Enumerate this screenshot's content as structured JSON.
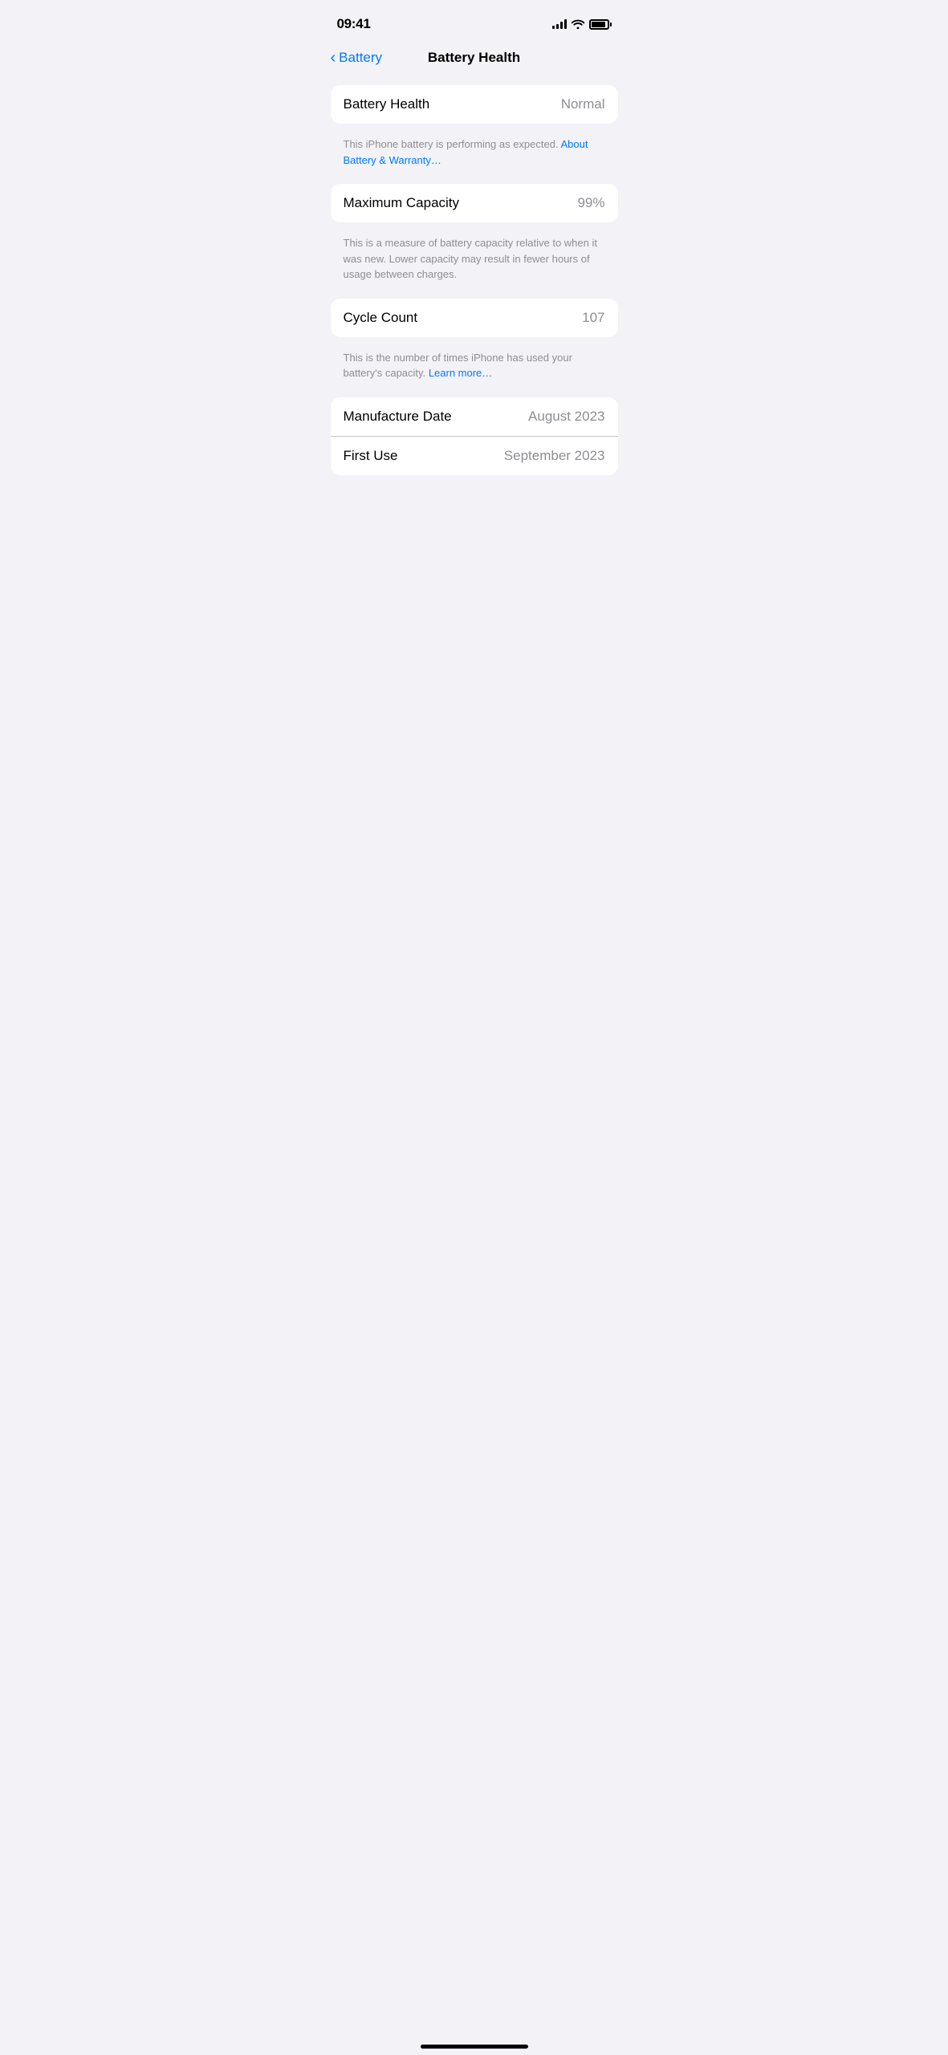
{
  "statusBar": {
    "time": "09:41",
    "signalBars": 4,
    "wifi": true,
    "battery": 90
  },
  "navigation": {
    "backLabel": "Battery",
    "title": "Battery Health"
  },
  "sections": {
    "batteryHealth": {
      "label": "Battery Health",
      "value": "Normal",
      "description": "This iPhone battery is performing as expected.",
      "linkText": "About Battery & Warranty…"
    },
    "maximumCapacity": {
      "label": "Maximum Capacity",
      "value": "99%",
      "description": "This is a measure of battery capacity relative to when it was new. Lower capacity may result in fewer hours of usage between charges."
    },
    "cycleCount": {
      "label": "Cycle Count",
      "value": "107",
      "description": "This is the number of times iPhone has used your battery's capacity.",
      "linkText": "Learn more…"
    },
    "manufactureDate": {
      "label": "Manufacture Date",
      "value": "August 2023"
    },
    "firstUse": {
      "label": "First Use",
      "value": "September 2023"
    }
  }
}
